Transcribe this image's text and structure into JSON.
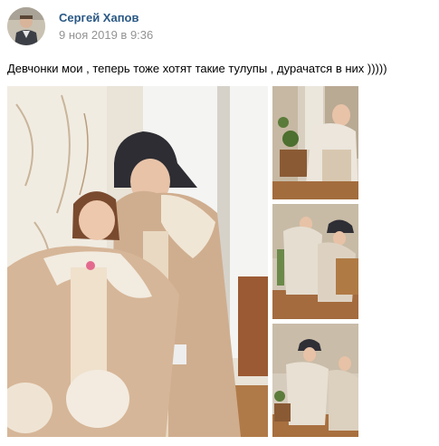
{
  "post": {
    "author": "Сергей Хапов",
    "date": "9 ноя 2019 в 9:36",
    "text": "Девчонки мои , теперь тоже хотят такие тулупы , дурачатся в них )))))"
  },
  "colors": {
    "author_link": "#2a5885",
    "date_gray": "#939393"
  }
}
